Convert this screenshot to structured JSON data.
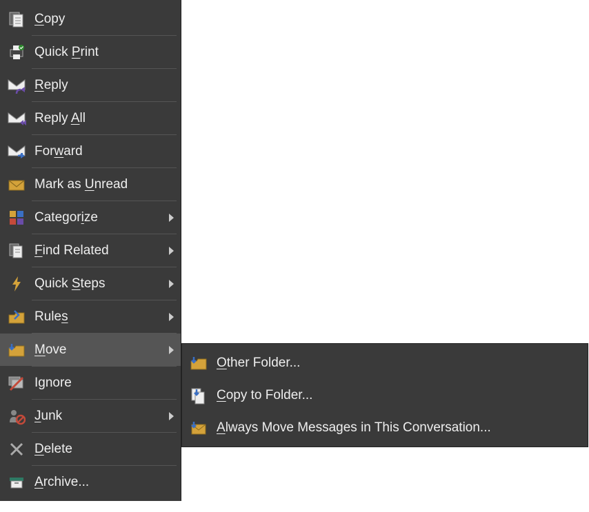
{
  "menu": {
    "copy": {
      "pre": "",
      "u": "C",
      "post": "opy"
    },
    "quickPrint": {
      "pre": "Quick ",
      "u": "P",
      "post": "rint"
    },
    "reply": {
      "pre": "",
      "u": "R",
      "post": "eply"
    },
    "replyAll": {
      "pre": "Reply ",
      "u": "A",
      "post": "ll"
    },
    "forward": {
      "pre": "For",
      "u": "w",
      "post": "ard"
    },
    "markUnread": {
      "pre": "Mark as ",
      "u": "U",
      "post": "nread"
    },
    "categorize": {
      "pre": "Categor",
      "u": "i",
      "post": "ze"
    },
    "findRelated": {
      "pre": "",
      "u": "F",
      "post": "ind Related"
    },
    "quickSteps": {
      "pre": "Quick ",
      "u": "S",
      "post": "teps"
    },
    "rules": {
      "pre": "Rule",
      "u": "s",
      "post": ""
    },
    "move": {
      "pre": "",
      "u": "M",
      "post": "ove"
    },
    "ignore": {
      "pre": "Ignore",
      "u": "",
      "post": ""
    },
    "junk": {
      "pre": "",
      "u": "J",
      "post": "unk"
    },
    "delete": {
      "pre": "",
      "u": "D",
      "post": "elete"
    },
    "archive": {
      "pre": "",
      "u": "A",
      "post": "rchive..."
    }
  },
  "submenu": {
    "otherFolder": {
      "pre": "",
      "u": "O",
      "post": "ther Folder..."
    },
    "copyToFolder": {
      "pre": "",
      "u": "C",
      "post": "opy to Folder..."
    },
    "alwaysMove": {
      "pre": "",
      "u": "A",
      "post": "lways Move Messages in This Conversation..."
    }
  }
}
